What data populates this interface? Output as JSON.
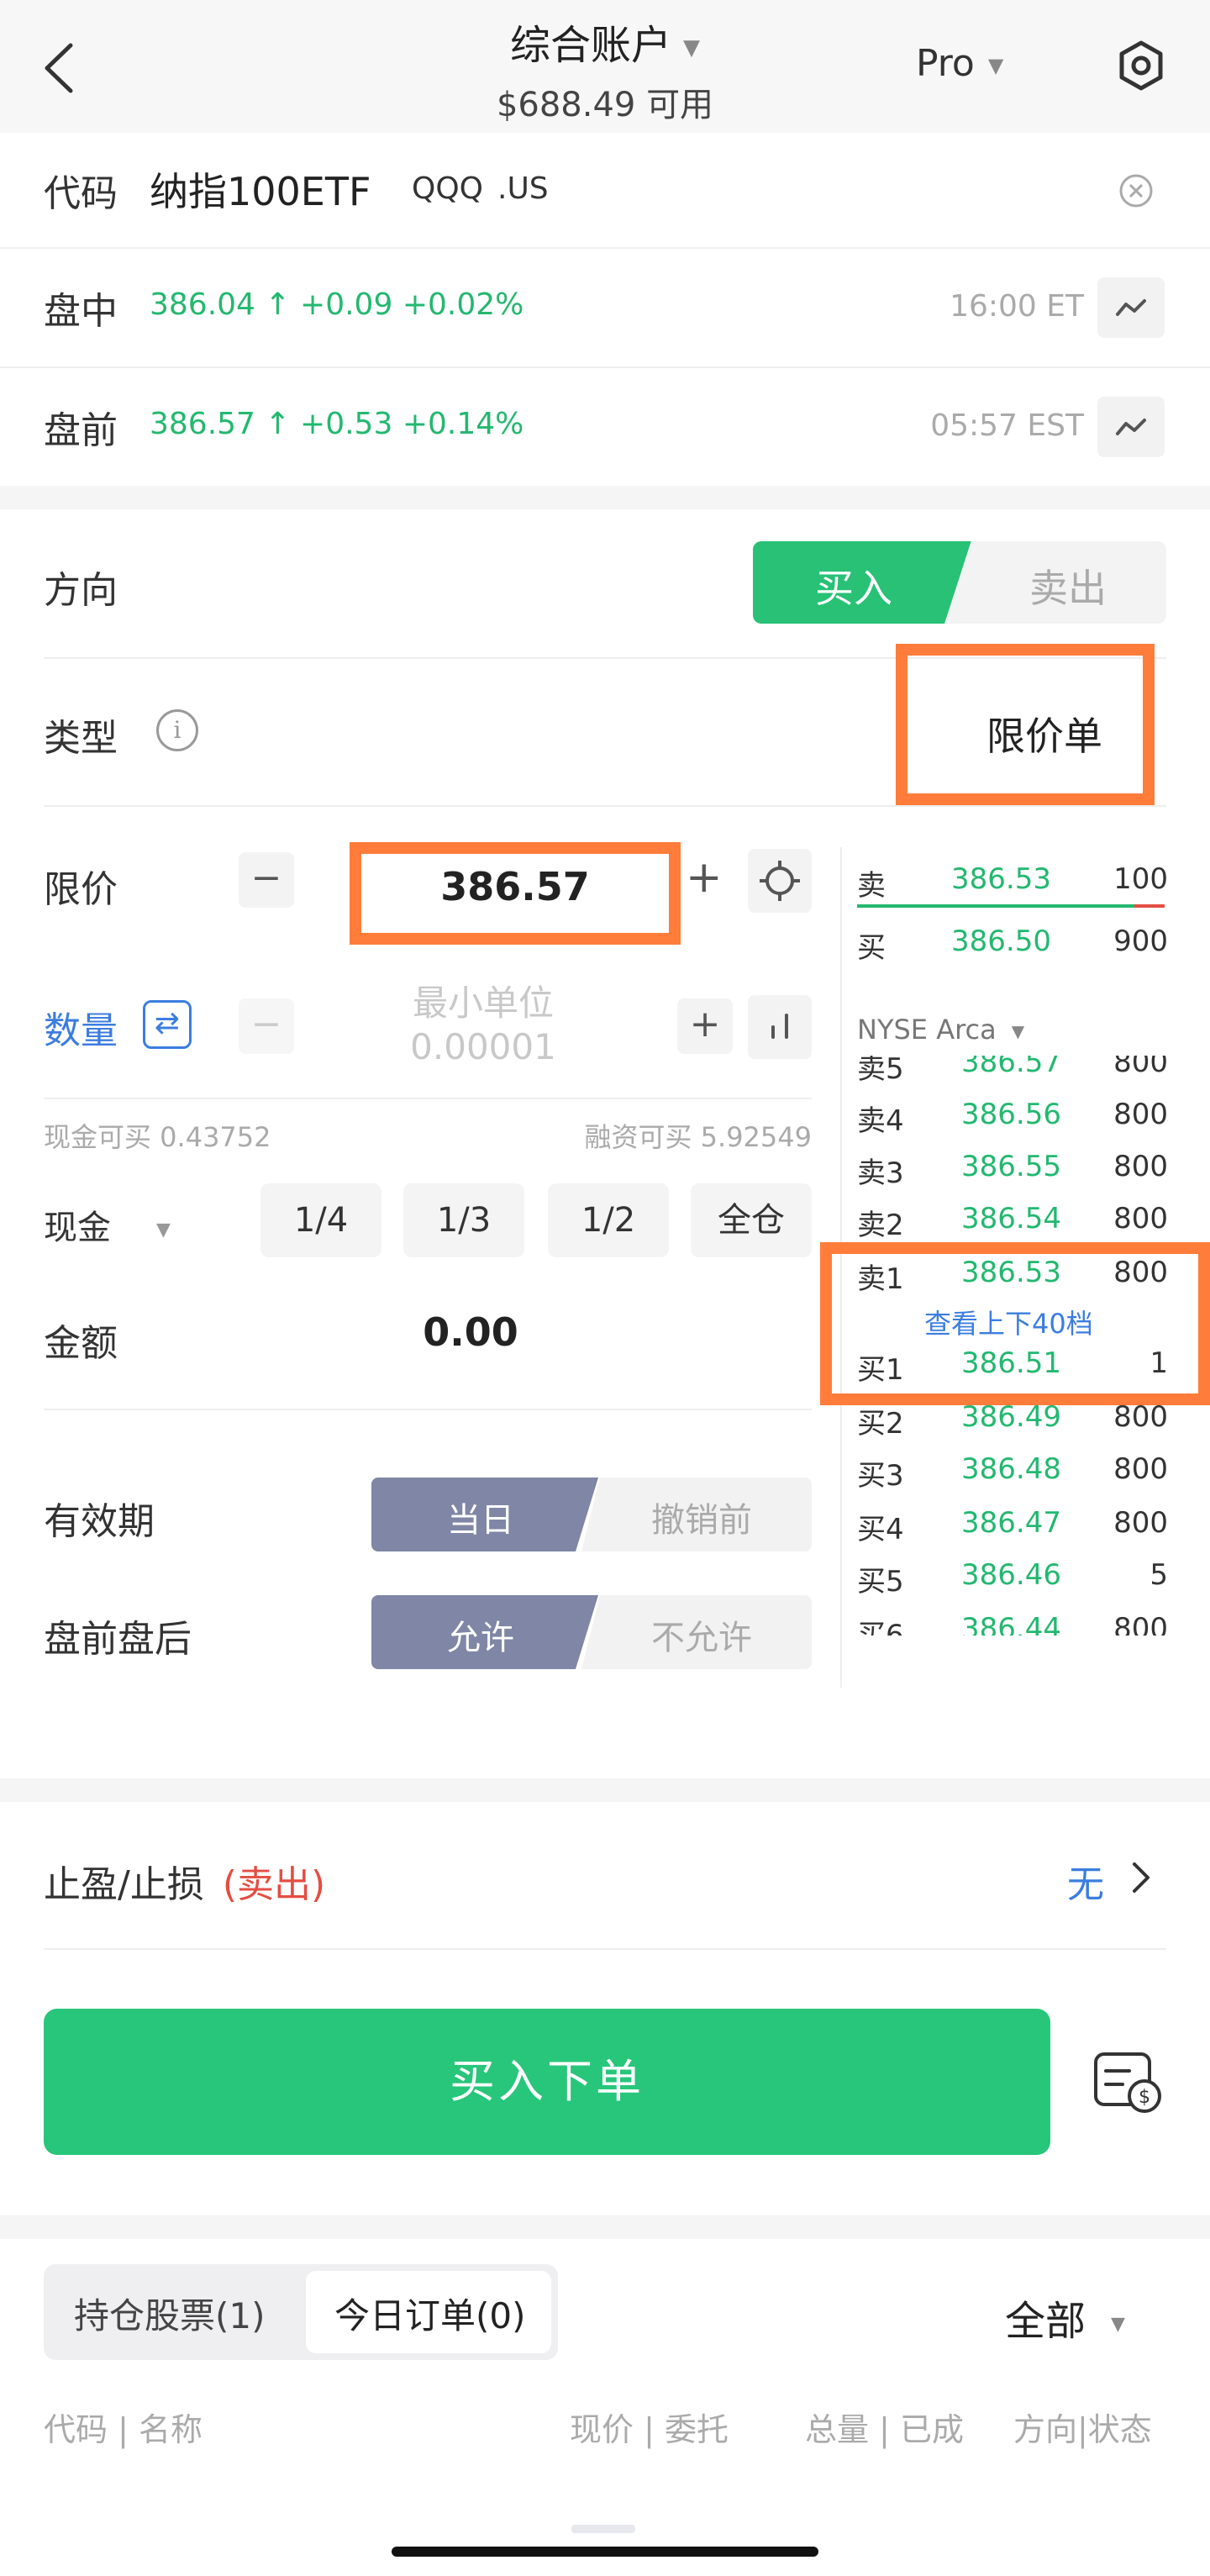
{
  "header": {
    "account_title": "综合账户",
    "available": "$688.49 可用",
    "mode": "Pro"
  },
  "symbol": {
    "label": "代码",
    "name": "纳指100ETF",
    "ticker": "QQQ",
    "market": ".US"
  },
  "quotes": [
    {
      "label": "盘中",
      "price": "386.04",
      "change": "+0.09",
      "pct": "+0.02%",
      "time": "16:00 ET"
    },
    {
      "label": "盘前",
      "price": "386.57",
      "change": "+0.53",
      "pct": "+0.14%",
      "time": "05:57 EST"
    }
  ],
  "order": {
    "direction_label": "方向",
    "buy": "买入",
    "sell": "卖出",
    "type_label": "类型",
    "type_value": "限价单",
    "limit_label": "限价",
    "limit_value": "386.57",
    "qty_label": "数量",
    "qty_placeholder_1": "最小单位",
    "qty_placeholder_2": "0.00001",
    "cash_can_buy": "现金可买 0.43752",
    "margin_can_buy": "融资可买 5.92549",
    "pay_method": "现金",
    "fractions": [
      "1/4",
      "1/3",
      "1/2",
      "全仓"
    ],
    "amount_label": "金额",
    "amount_value": "0.00",
    "validity_label": "有效期",
    "validity_on": "当日",
    "validity_off": "撤销前",
    "ext_label": "盘前盘后",
    "ext_on": "允许",
    "ext_off": "不允许"
  },
  "orderbook": {
    "top_ask": {
      "label": "卖",
      "price": "386.53",
      "qty": "100"
    },
    "top_bid": {
      "label": "买",
      "price": "386.50",
      "qty": "900"
    },
    "exchange": "NYSE Arca",
    "rows": [
      {
        "label": "卖5",
        "price": "386.57",
        "qty": "800"
      },
      {
        "label": "卖4",
        "price": "386.56",
        "qty": "800"
      },
      {
        "label": "卖3",
        "price": "386.55",
        "qty": "800"
      },
      {
        "label": "卖2",
        "price": "386.54",
        "qty": "800"
      },
      {
        "label": "卖1",
        "price": "386.53",
        "qty": "800"
      },
      {
        "label": "买1",
        "price": "386.51",
        "qty": "1"
      },
      {
        "label": "买2",
        "price": "386.49",
        "qty": "800"
      },
      {
        "label": "买3",
        "price": "386.48",
        "qty": "800"
      },
      {
        "label": "买4",
        "price": "386.47",
        "qty": "800"
      },
      {
        "label": "买5",
        "price": "386.46",
        "qty": "5"
      },
      {
        "label": "买6",
        "price": "386.44",
        "qty": "800"
      }
    ],
    "view_more": "查看上下40档"
  },
  "stop": {
    "label": "止盈/止损",
    "side": "(卖出)",
    "value": "无"
  },
  "submit_label": "买入下单",
  "positions": {
    "tab_holdings": "持仓股票(1)",
    "tab_orders": "今日订单(0)",
    "filter": "全部",
    "col_code": "代码 | 名称",
    "col_price": "现价 | 委托",
    "col_qty": "总量 | 已成",
    "col_status": "方向|状态"
  },
  "colors": {
    "buy_green": "#28c176",
    "highlight_orange": "#ff7c3a",
    "segment_active": "#7f86a6",
    "link_blue": "#3b7de0",
    "sell_red": "#e54d42"
  }
}
